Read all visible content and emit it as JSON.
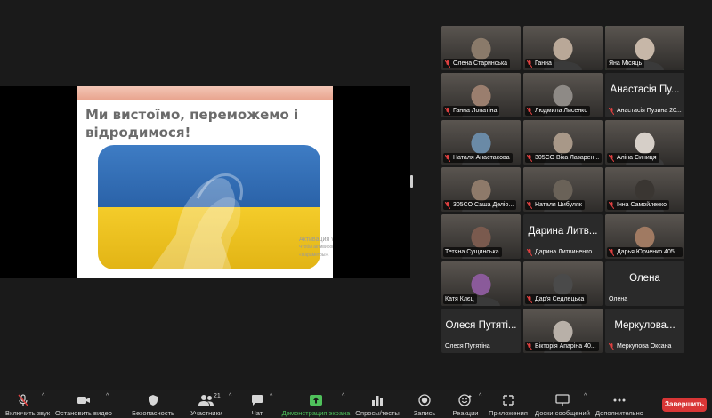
{
  "slide": {
    "title": "Ми вистоїмо, переможемо і відродимося!",
    "watermark_line1": "Активация Windows",
    "watermark_line2": "Чтобы активировать Windows, перейдите в раздел «Параметры»."
  },
  "participants": [
    {
      "name": "Олена Старинська",
      "muted": true,
      "video": true,
      "tone": "#8a7a6a"
    },
    {
      "name": "Ганна",
      "muted": true,
      "video": true,
      "tone": "#b9a898"
    },
    {
      "name": "Яна Місяць",
      "muted": false,
      "video": true,
      "tone": "#c7b7a8",
      "active": true
    },
    {
      "name": "Ганна Лопатіна",
      "muted": true,
      "video": true,
      "tone": "#9a7e6e"
    },
    {
      "name": "Людмила Лисенко",
      "muted": true,
      "video": true,
      "tone": "#8e8a86"
    },
    {
      "name": "Анастасія Пузина 20...",
      "big": "Анастасія Пу...",
      "muted": true,
      "video": false
    },
    {
      "name": "Наталя Анастасова",
      "muted": true,
      "video": true,
      "tone": "#6a8aa6"
    },
    {
      "name": "305СО Віка Лазарен...",
      "muted": true,
      "video": true,
      "tone": "#a89888"
    },
    {
      "name": "Аліна Синиця",
      "muted": true,
      "video": true,
      "tone": "#d6cfc8"
    },
    {
      "name": "305СО Саша Деліо...",
      "muted": true,
      "video": true,
      "tone": "#8e7a6a"
    },
    {
      "name": "Наталя Цибуляк",
      "muted": true,
      "video": true,
      "tone": "#6a6258"
    },
    {
      "name": "Інна Самойленко",
      "muted": true,
      "video": true,
      "tone": "#3a3632"
    },
    {
      "name": "Тетяна Сущинська",
      "muted": false,
      "video": true,
      "tone": "#7a5a4e"
    },
    {
      "name": "Дарина Литвиненко",
      "big": "Дарина Литв...",
      "muted": true,
      "video": false
    },
    {
      "name": "Дарья Юрченко 405...",
      "muted": true,
      "video": true,
      "tone": "#a07a62"
    },
    {
      "name": "Катя Клєц",
      "muted": false,
      "video": true,
      "tone": "#8a5a9a"
    },
    {
      "name": "Дар'я Седлецька",
      "muted": true,
      "video": true,
      "tone": "#4a4a4a"
    },
    {
      "name": "Олена",
      "big": "Олена",
      "muted": false,
      "video": false
    },
    {
      "name": "Олеся Путятіна",
      "big": "Олеся Путяті...",
      "muted": false,
      "video": false
    },
    {
      "name": "Вікторія Апаріна 40...",
      "muted": true,
      "video": true,
      "tone": "#b8b0a8"
    },
    {
      "name": "Меркулова Оксана",
      "big": "Меркулова...",
      "muted": true,
      "video": false
    }
  ],
  "toolbar": {
    "unmute": "Включить звук",
    "stop_video": "Остановить видео",
    "security": "Безопасность",
    "participants": "Участники",
    "participants_count": "21",
    "chat": "Чат",
    "share": "Демонстрация экрана",
    "polls": "Опросы/тесты",
    "record": "Запись",
    "reactions": "Реакции",
    "apps": "Приложения",
    "whiteboards": "Доски сообщений",
    "more": "Дополнительно",
    "end": "Завершить"
  },
  "colors": {
    "accent_green": "#4fc15b",
    "end_red": "#d93636",
    "flag_blue": "#2f6fb8",
    "flag_yellow": "#f0c419"
  }
}
